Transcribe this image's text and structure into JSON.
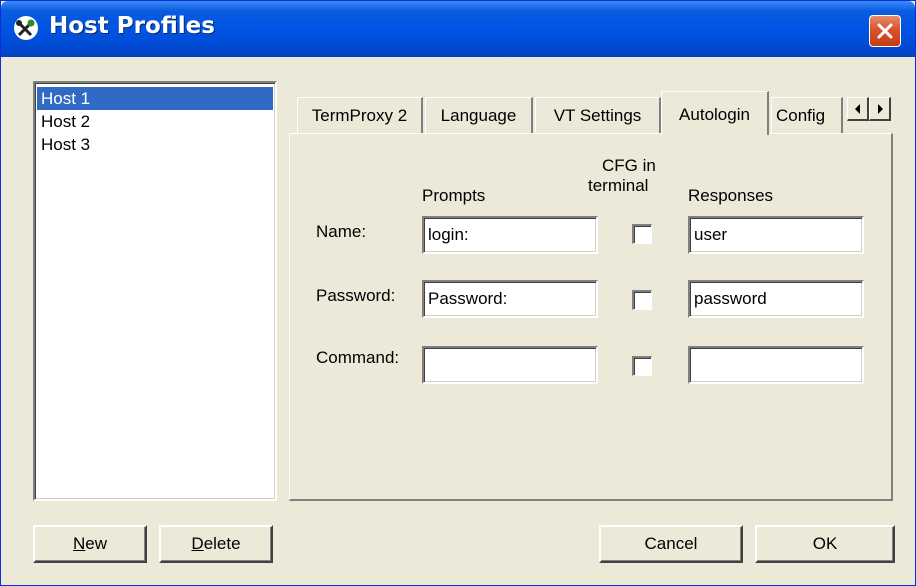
{
  "window": {
    "title": "Host Profiles"
  },
  "hosts": [
    "Host 1",
    "Host 2",
    "Host 3"
  ],
  "tabs": [
    "TermProxy 2",
    "Language",
    "VT Settings",
    "Autologin",
    "Config"
  ],
  "active_tab": "Autologin",
  "autologin": {
    "prompts_header": "Prompts",
    "cfg_header_line1": "CFG in",
    "cfg_header_line2": "terminal",
    "responses_header": "Responses",
    "rows": [
      {
        "label": "Name:",
        "prompt": "login:",
        "cfg_in_terminal": false,
        "response": "user"
      },
      {
        "label": "Password:",
        "prompt": "Password:",
        "cfg_in_terminal": false,
        "response": "password"
      },
      {
        "label": "Command:",
        "prompt": "",
        "cfg_in_terminal": false,
        "response": ""
      }
    ]
  },
  "buttons": {
    "new_first": "N",
    "new_rest": "ew",
    "delete_first": "D",
    "delete_rest": "elete",
    "cancel": "Cancel",
    "ok": "OK"
  },
  "colors": {
    "titlebar": "#0054e3",
    "selection": "#316ac5",
    "face": "#ece9d8",
    "close": "#d9532c"
  }
}
